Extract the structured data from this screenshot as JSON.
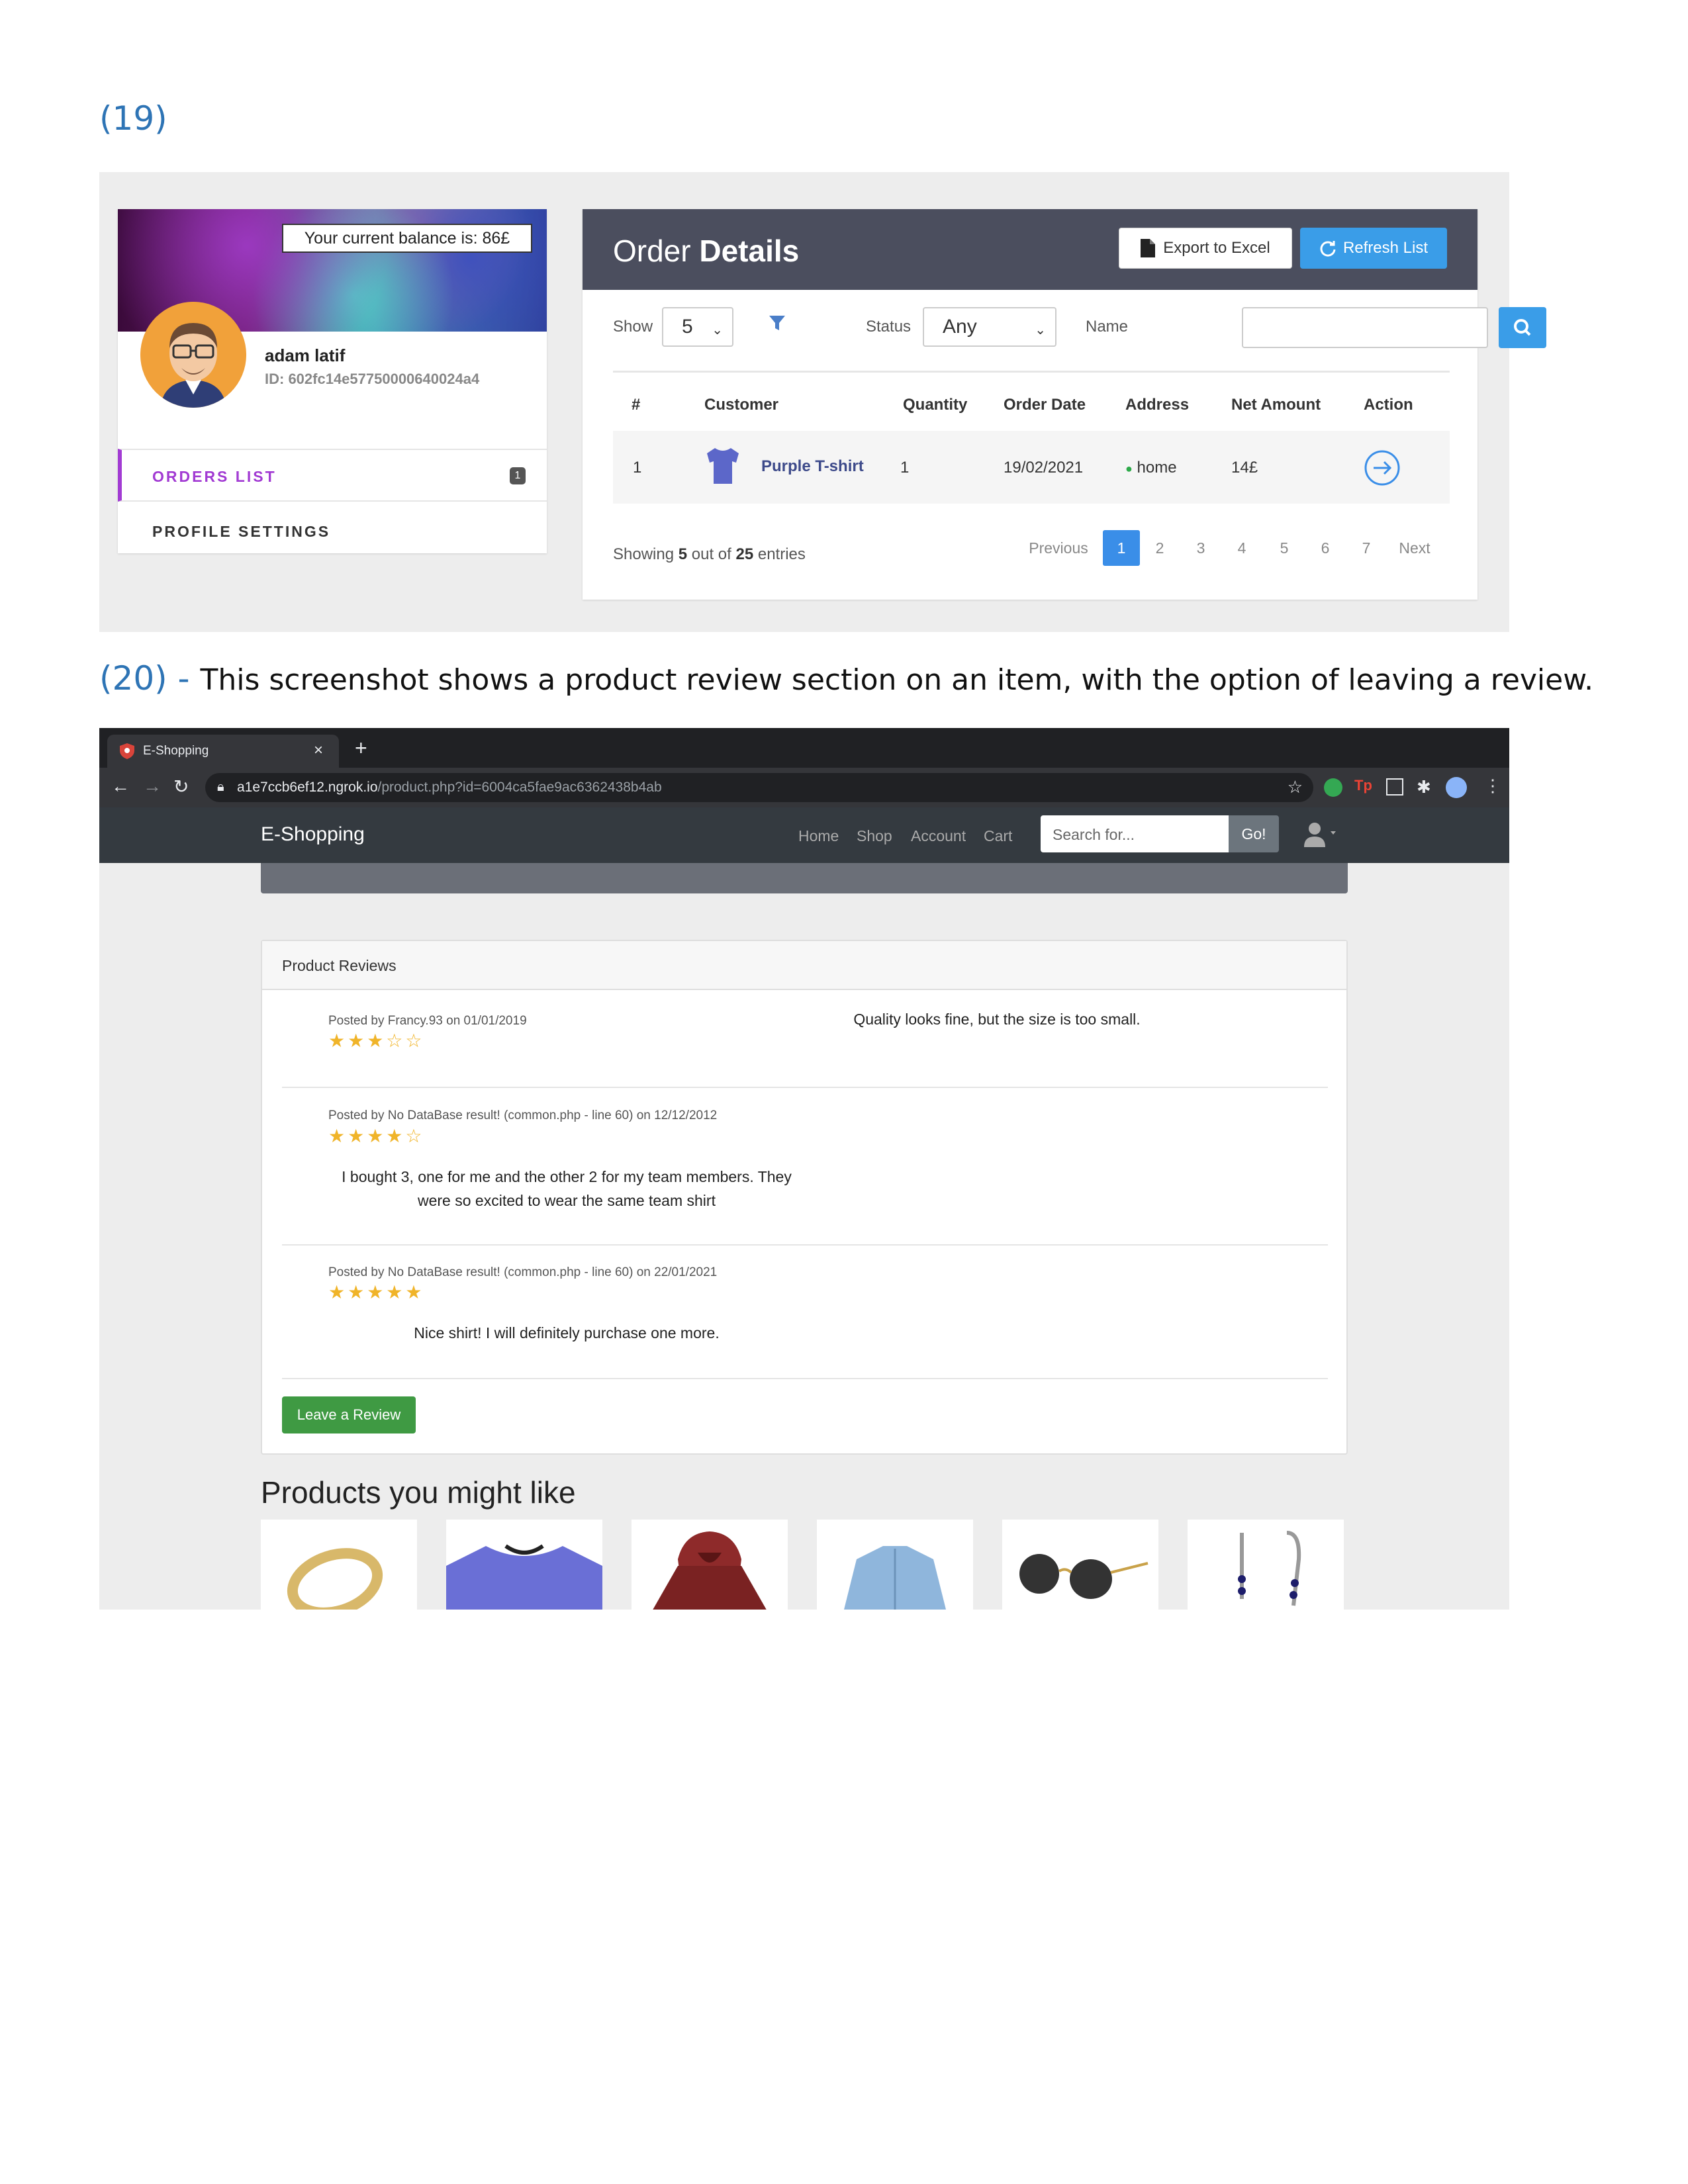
{
  "doc": {
    "heading19": "(19)",
    "heading20_num": "(20)",
    "heading20_dash": " - ",
    "heading20_desc": "This screenshot shows a product review section on an item, with the option of leaving a review."
  },
  "profile": {
    "balance_text": "Your current balance is: 86£",
    "name": "adam latif",
    "id_text": "ID: 602fc14e57750000640024a4",
    "menu": [
      {
        "label": "ORDERS LIST",
        "badge": "1"
      },
      {
        "label": "PROFILE SETTINGS"
      }
    ]
  },
  "orders": {
    "title_light": "Order ",
    "title_bold": "Details",
    "export_label": "Export to Excel",
    "refresh_label": "Refresh List",
    "filters": {
      "show_label": "Show",
      "show_value": "5",
      "status_label": "Status",
      "status_value": "Any",
      "name_label": "Name",
      "name_value": ""
    },
    "columns": [
      "#",
      "Customer",
      "Quantity",
      "Order Date",
      "Address",
      "Net Amount",
      "Action"
    ],
    "rows": [
      {
        "num": "1",
        "customer": "Purple T-shirt",
        "quantity": "1",
        "date": "19/02/2021",
        "address": "home",
        "amount": "14£"
      }
    ],
    "showing": {
      "prefix": "Showing ",
      "count": "5",
      "mid": " out of ",
      "total": "25",
      "suffix": " entries"
    },
    "pagination": [
      "Previous",
      "1",
      "2",
      "3",
      "4",
      "5",
      "6",
      "7",
      "Next"
    ],
    "active_page": "1",
    "colors": {
      "header": "#4b4e5e",
      "primary": "#3a9de8",
      "accent": "#a23bd3"
    }
  },
  "browser": {
    "tab_title": "E-Shopping",
    "tab_close": "×",
    "new_tab": "+",
    "url_host": "a1e7ccb6ef12.ngrok.io",
    "url_path": "/product.php?id=6004ca5fae9ac6362438b4ab"
  },
  "site": {
    "brand": "E-Shopping",
    "nav": [
      "Home",
      "Shop",
      "Account",
      "Cart"
    ],
    "search_placeholder": "Search for...",
    "go_label": "Go!"
  },
  "reviews": {
    "title": "Product Reviews",
    "items": [
      {
        "meta": "Posted by Francy.93 on 01/01/2019",
        "stars": "★★★☆☆",
        "rating": 3,
        "text_line1": "Quality looks fine, but the size is too small.",
        "text_line2": ""
      },
      {
        "meta": "Posted by No DataBase result! (common.php - line 60) on 12/12/2012",
        "stars": "★★★★☆",
        "rating": 4,
        "text_line1": "I bought 3, one for me and the other 2 for my team members. They",
        "text_line2": "were so excited to wear the same team shirt"
      },
      {
        "meta": "Posted by No DataBase result! (common.php - line 60) on 22/01/2021",
        "stars": "★★★★★",
        "rating": 5,
        "text_line1": "Nice shirt! I will definitely purchase one more.",
        "text_line2": ""
      }
    ],
    "leave_label": "Leave a Review",
    "colors": {
      "star": "#f0b429",
      "leave_button": "#3f9a43"
    }
  },
  "products": {
    "title": "Products you might like",
    "items": [
      "ring-image",
      "purple-tshirt-image",
      "red-hoodie-image",
      "denim-shirt-image",
      "sunglasses-image",
      "earrings-image"
    ]
  }
}
